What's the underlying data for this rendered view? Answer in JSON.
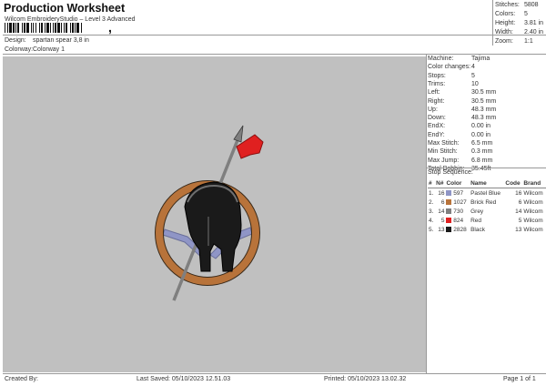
{
  "header": {
    "title": "Production Worksheet",
    "subtitle": "Wilcom EmbroideryStudio – Level 3 Advanced",
    "barcode_mark": ","
  },
  "design": {
    "label": "Design:",
    "value": "spartan spear 3,8 in"
  },
  "colorway": {
    "label": "Colorway:",
    "value": "Colorway 1"
  },
  "summary": [
    {
      "label": "Stitches:",
      "value": "5808"
    },
    {
      "label": "Colors:",
      "value": "5"
    },
    {
      "label": "Height:",
      "value": "3.81 in"
    },
    {
      "label": "Width:",
      "value": "2.40 in"
    },
    {
      "label": "Zoom:",
      "value": "1:1"
    }
  ],
  "machine_stats": [
    {
      "label": "Machine:",
      "value": "Tajima"
    },
    {
      "label": "Color changes:",
      "value": "4"
    },
    {
      "label": "Stops:",
      "value": "5"
    },
    {
      "label": "Trims:",
      "value": "10"
    },
    {
      "label": "Left:",
      "value": "30.5 mm"
    },
    {
      "label": "Right:",
      "value": "30.5 mm"
    },
    {
      "label": "Up:",
      "value": "48.3 mm"
    },
    {
      "label": "Down:",
      "value": "48.3 mm"
    },
    {
      "label": "EndX:",
      "value": "0.00 in"
    },
    {
      "label": "EndY:",
      "value": "0.00 in"
    },
    {
      "label": "Max Stitch:",
      "value": "6.5 mm"
    },
    {
      "label": "Min Stitch:",
      "value": "0.3 mm"
    },
    {
      "label": "Max Jump:",
      "value": "6.8 mm"
    },
    {
      "label": "Total Bobbin:",
      "value": "35.45ft"
    }
  ],
  "stop_sequence": {
    "title": "Stop Sequence:",
    "headers": {
      "num": "#",
      "n": "N#",
      "color": "Color",
      "name": "Name",
      "code": "Code",
      "brand": "Brand"
    },
    "rows": [
      {
        "num": "1.",
        "n": "16",
        "color": "#8f95c6",
        "code_num": "597",
        "name": "Pastel Blue",
        "code": "16",
        "brand": "Wilcom"
      },
      {
        "num": "2.",
        "n": "6",
        "color": "#b8733a",
        "code_num": "1027",
        "name": "Brick Red",
        "code": "6",
        "brand": "Wilcom"
      },
      {
        "num": "3.",
        "n": "14",
        "color": "#7f7f7f",
        "code_num": "730",
        "name": "Grey",
        "code": "14",
        "brand": "Wilcom"
      },
      {
        "num": "4.",
        "n": "5",
        "color": "#e02020",
        "code_num": "824",
        "name": "Red",
        "code": "5",
        "brand": "Wilcom"
      },
      {
        "num": "5.",
        "n": "13",
        "color": "#1a1a1a",
        "code_num": "2828",
        "name": "Black",
        "code": "13",
        "brand": "Wilcom"
      }
    ]
  },
  "footer": {
    "created_by": "Created By:",
    "last_saved": "Last Saved: 05/10/2023 12.51.03",
    "printed": "Printed: 05/10/2023 13.02.32",
    "page": "Page 1 of 1"
  },
  "canvas_color": "#c0c0c0"
}
